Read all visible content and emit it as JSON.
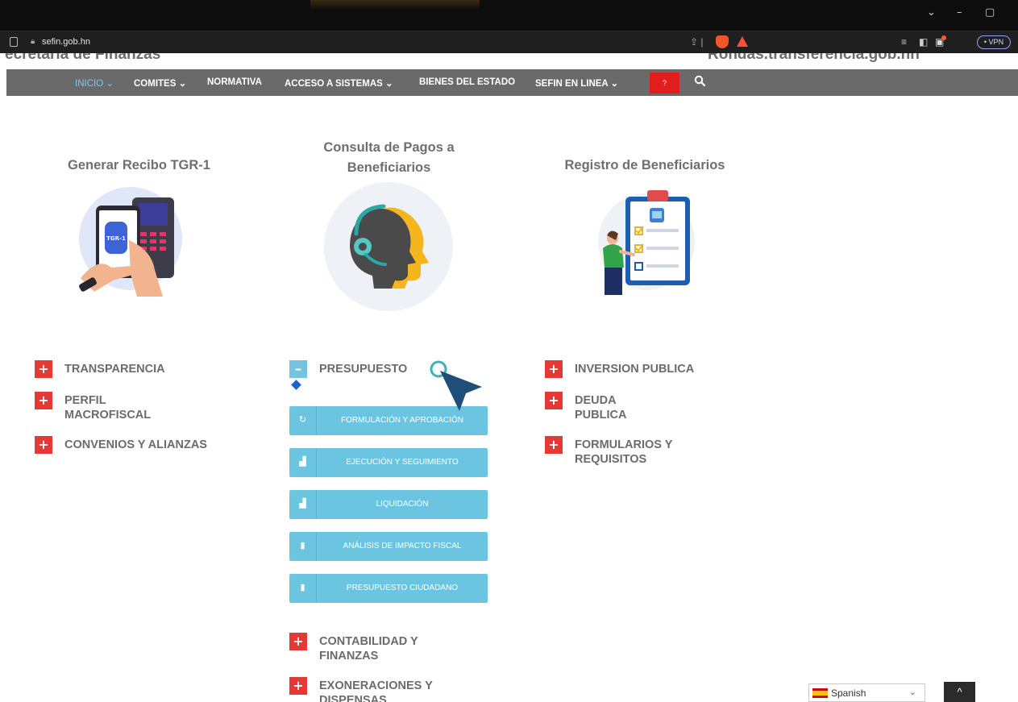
{
  "browser": {
    "url": "sefin.gob.hn",
    "vpn_label": "• VPN",
    "window_controls": [
      "⌄",
      "–",
      "▢"
    ]
  },
  "site_header": {
    "partial_left": "ecretaría de Finanzas",
    "partial_right": "Rondas.transferencia.gob.hn"
  },
  "nav": {
    "items": [
      "INICIO ⌄",
      "COMITES ⌄",
      "NORMATIVA",
      "ACCESO A SISTEMAS ⌄",
      "BIENES DEL ESTADO",
      "SEFIN EN LINEA ⌄"
    ],
    "red_badge": "?",
    "search_icon": "search-icon"
  },
  "tiles": [
    {
      "title_line1": "Generar Recibo TGR-1",
      "title_line2": "",
      "badge": "TGR-1",
      "icon": "pos-terminal-phone-illustration"
    },
    {
      "title_line1": "Consulta de Pagos a",
      "title_line2": "Beneficiarios",
      "icon": "headset-head-illustration"
    },
    {
      "title_line1": "Registro de Beneficiarios",
      "title_line2": "",
      "icon": "clipboard-checklist-illustration"
    }
  ],
  "accordion": {
    "left": [
      {
        "line1": "TRANSPARENCIA",
        "line2": ""
      },
      {
        "line1": "PERFIL",
        "line2": "MACROFISCAL"
      },
      {
        "line1": "CONVENIOS Y ALIANZAS",
        "line2": ""
      }
    ],
    "center_open": {
      "label": "PRESUPUESTO",
      "toggle": "–"
    },
    "sub_items": [
      {
        "label": "FORMULACIÓN Y APROBACIÓN",
        "icon": "refresh-icon"
      },
      {
        "label": "EJECUCIÓN Y SEGUIMIENTO",
        "icon": "chart-icon"
      },
      {
        "label": "LIQUIDACIÓN",
        "icon": "chart-icon"
      },
      {
        "label": "ANÁLISIS DE IMPACTO FISCAL",
        "icon": "book-icon"
      },
      {
        "label": "PRESUPUESTO CIUDADANO",
        "icon": "document-icon"
      }
    ],
    "center_more": [
      {
        "line1": "CONTABILIDAD Y",
        "line2": "FINANZAS"
      },
      {
        "line1": "EXONERACIONES Y",
        "line2": "DISPENSAS"
      }
    ],
    "right": [
      {
        "line1": "INVERSION PUBLICA",
        "line2": ""
      },
      {
        "line1": "DEUDA",
        "line2": "PUBLICA"
      },
      {
        "line1": "FORMULARIOS Y",
        "line2": "REQUISITOS"
      }
    ],
    "plus": "+"
  },
  "language": {
    "selected": "Spanish",
    "chevron": "⌄"
  },
  "back_to_top": "^",
  "colors": {
    "nav_bg": "#6a6a6a",
    "active_nav": "#7dc9f1",
    "plus_red": "#e53935",
    "sub_btn": "#6cc5e0",
    "cursor": "#1f4e79"
  }
}
